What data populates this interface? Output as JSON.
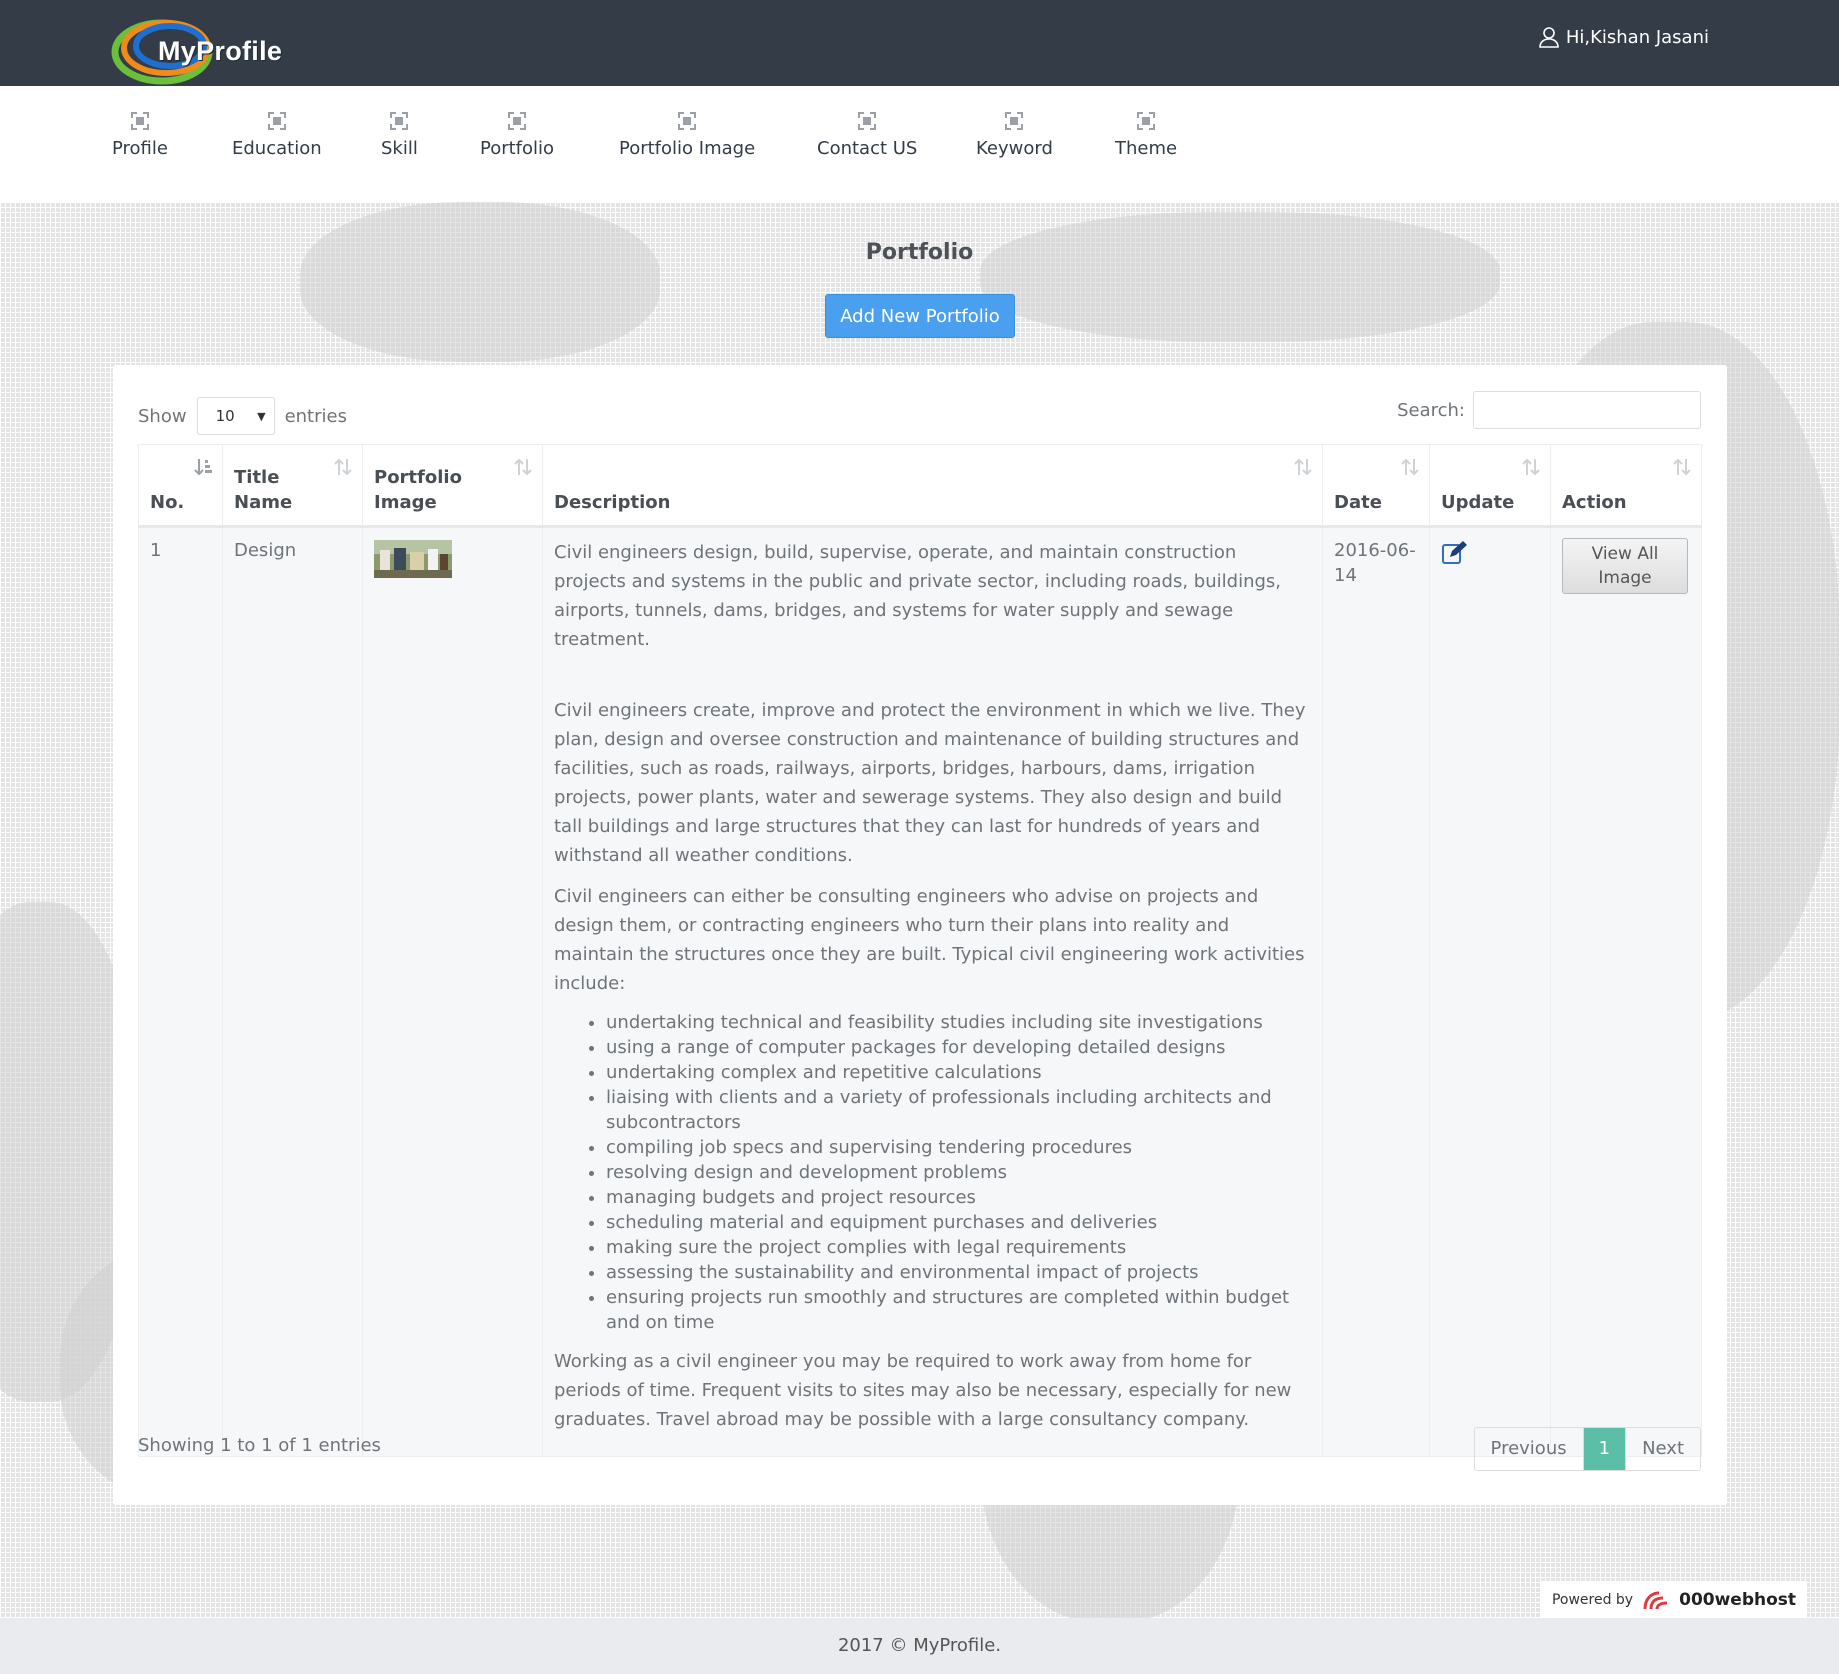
{
  "header": {
    "logo_text": "MyProfile",
    "user_greeting": "Hi,Kishan Jasani"
  },
  "nav": {
    "items": [
      {
        "label": "Profile"
      },
      {
        "label": "Education"
      },
      {
        "label": "Skill"
      },
      {
        "label": "Portfolio"
      },
      {
        "label": "Portfolio Image"
      },
      {
        "label": "Contact US"
      },
      {
        "label": "Keyword"
      },
      {
        "label": "Theme"
      }
    ]
  },
  "page": {
    "title": "Portfolio",
    "add_button": "Add New Portfolio"
  },
  "table_controls": {
    "show_label": "Show",
    "entries_value": "10",
    "entries_label": "entries",
    "search_label": "Search:"
  },
  "table": {
    "columns": [
      "No.",
      "Title Name",
      "Portfolio Image",
      "Description",
      "Date",
      "Update",
      "Action"
    ],
    "rows": [
      {
        "no": "1",
        "title": "Design",
        "date": "2016-06-14",
        "action_label": "View All Image",
        "description": {
          "p1": "Civil engineers design, build, supervise, operate, and maintain construction projects and systems in the public and private sector, including roads, buildings, airports, tunnels, dams, bridges, and systems for water supply and sewage treatment.",
          "p2": "Civil engineers create, improve and protect the environment in which we live. They plan, design and oversee construction and maintenance of building structures and facilities, such as roads, railways, airports, bridges, harbours, dams, irrigation projects, power plants, water and sewerage systems. They also design and build tall buildings and large structures that they can last for hundreds of years and withstand all weather conditions.",
          "p3": "Civil engineers can either be consulting engineers who advise on projects and design them, or contracting engineers who turn their plans into reality and maintain the structures once they are built. Typical civil engineering work activities include:",
          "bullets": [
            "undertaking technical and feasibility studies including site investigations",
            "using a range of computer packages for developing detailed designs",
            "undertaking complex and repetitive calculations",
            "liaising with clients and a variety of professionals including architects and subcontractors",
            "compiling job specs and supervising tendering procedures",
            "resolving design and development problems",
            "managing budgets and project resources",
            "scheduling material and equipment purchases and deliveries",
            "making sure the project complies with legal requirements",
            "assessing the sustainability and environmental impact of projects",
            "ensuring projects run smoothly and structures are completed within budget and on time"
          ],
          "p4": "Working as a civil engineer you may be required to work away from home for periods of time. Frequent visits to sites may also be necessary, especially for new graduates. Travel abroad may be possible with a large consultancy company."
        }
      }
    ]
  },
  "pagination": {
    "info": "Showing 1 to 1 of 1 entries",
    "previous": "Previous",
    "current": "1",
    "next": "Next"
  },
  "powered": {
    "label": "Powered by",
    "brand": "000webhost"
  },
  "footer": {
    "text": "2017 © MyProfile."
  },
  "colors": {
    "topbar": "#333c47",
    "primary_button": "#4a9fef",
    "active_page": "#5bbfa8"
  }
}
